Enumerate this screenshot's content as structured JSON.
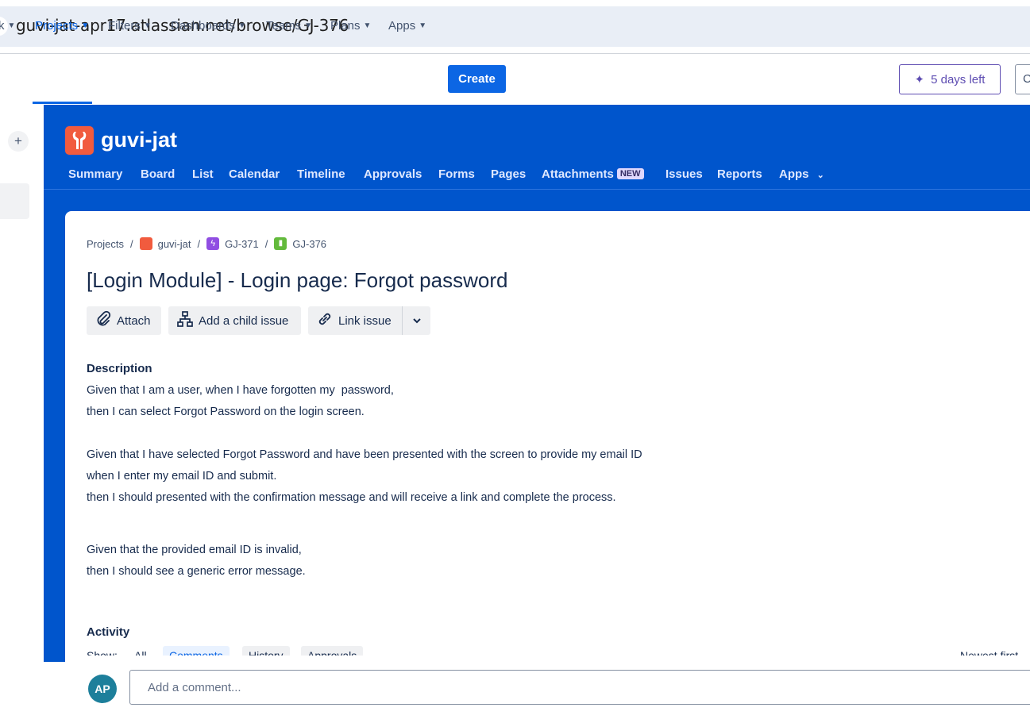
{
  "browser": {
    "url": "guvi-jat-apr17.atlassian.net/browse/GJ-376"
  },
  "topnav": {
    "items": [
      {
        "label": "k",
        "active": false
      },
      {
        "label": "Projects",
        "active": true
      },
      {
        "label": "Filters",
        "active": false
      },
      {
        "label": "Dashboards",
        "active": false
      },
      {
        "label": "Teams",
        "active": false
      },
      {
        "label": "Plans",
        "active": false
      },
      {
        "label": "Apps",
        "active": false
      }
    ],
    "create_label": "Create",
    "trial_label": "5 days left",
    "extra_label": "C"
  },
  "sidebar": {
    "plus_label": "+"
  },
  "project": {
    "name": "guvi-jat",
    "tabs": [
      "Summary",
      "Board",
      "List",
      "Calendar",
      "Timeline",
      "Approvals",
      "Forms",
      "Pages",
      "Attachments",
      "Issues",
      "Reports",
      "Apps"
    ],
    "new_badge": "NEW"
  },
  "issue": {
    "breadcrumb": [
      "Projects",
      "guvi-jat",
      "GJ-371",
      "GJ-376"
    ],
    "title": "[Login Module] - Login page: Forgot password",
    "actions": {
      "attach": "Attach",
      "child": "Add a child issue",
      "link": "Link issue"
    },
    "description_label": "Description",
    "description_lines": [
      "Given that I am a user, when I have forgotten my  password,",
      "then I can select Forgot Password on the login screen.",
      "Given that I have selected Forgot Password and have been presented with the screen to provide my email ID",
      "when I enter my email ID and submit.",
      "then I should presented with the confirmation message and will receive a link and complete the process.",
      "Given that the provided email ID is invalid,",
      "then I should see a generic error message."
    ],
    "activity_label": "Activity",
    "activity_show": "Show:",
    "activity_filters": [
      "All",
      "Comments",
      "History",
      "Approvals"
    ],
    "activity_sort": "Newest first"
  },
  "comment": {
    "avatar_initials": "AP",
    "placeholder": "Add a comment..."
  },
  "colors": {
    "brand_blue": "#0055cc",
    "accent": "#0c66e4",
    "project_logo": "#f15b3e",
    "epic": "#904ee2",
    "story": "#63ba3c"
  }
}
